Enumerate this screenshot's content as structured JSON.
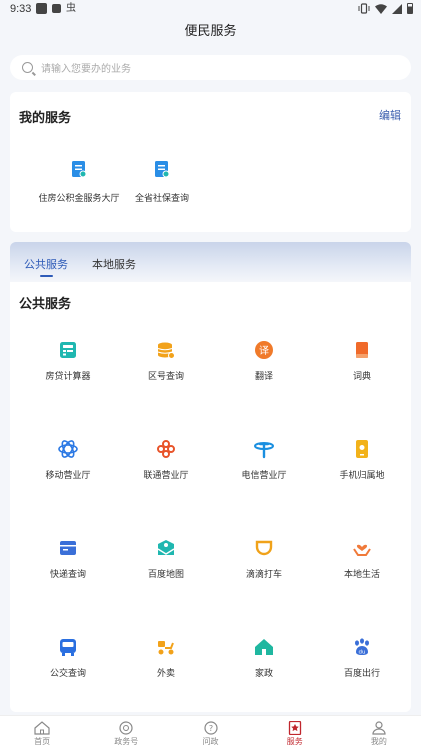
{
  "status_bar": {
    "time": "9:33",
    "notif_glyph": "虫"
  },
  "header": {
    "title": "便民服务"
  },
  "search": {
    "placeholder": "请输入您要办的业务"
  },
  "my_services": {
    "title": "我的服务",
    "edit_label": "编辑",
    "items": [
      {
        "label": "住房公积金服务大厅",
        "icon": "document-icon"
      },
      {
        "label": "全省社保查询",
        "icon": "document-icon"
      }
    ]
  },
  "tabs": [
    {
      "label": "公共服务",
      "active": true
    },
    {
      "label": "本地服务",
      "active": false
    }
  ],
  "public_services": {
    "title": "公共服务",
    "items": [
      {
        "label": "房贷计算器",
        "icon": "calculator-icon",
        "color": "#1fb7b0"
      },
      {
        "label": "区号查询",
        "icon": "coins-icon",
        "color": "#f2a21a"
      },
      {
        "label": "翻译",
        "icon": "translate-icon",
        "color": "#f07a2a"
      },
      {
        "label": "词典",
        "icon": "book-icon",
        "color": "#f06a2a"
      },
      {
        "label": "移动营业厅",
        "icon": "china-mobile-icon",
        "color": "#2a78e4"
      },
      {
        "label": "联通营业厅",
        "icon": "china-unicom-icon",
        "color": "#e8542a"
      },
      {
        "label": "电信营业厅",
        "icon": "china-telecom-icon",
        "color": "#1a8fe0"
      },
      {
        "label": "手机归属地",
        "icon": "phone-location-icon",
        "color": "#f2b21a"
      },
      {
        "label": "快递查询",
        "icon": "parcel-icon",
        "color": "#3a6fd8"
      },
      {
        "label": "百度地图",
        "icon": "map-icon",
        "color": "#1fb7b0"
      },
      {
        "label": "滴滴打车",
        "icon": "didi-icon",
        "color": "#f0a21a"
      },
      {
        "label": "本地生活",
        "icon": "hands-heart-icon",
        "color": "#f07a3a"
      },
      {
        "label": "公交查询",
        "icon": "bus-icon",
        "color": "#2a6fe0"
      },
      {
        "label": "外卖",
        "icon": "delivery-scooter-icon",
        "color": "#f2a21a"
      },
      {
        "label": "家政",
        "icon": "house-icon",
        "color": "#1fb7a0"
      },
      {
        "label": "百度出行",
        "icon": "paw-icon",
        "color": "#3a6fd8"
      }
    ]
  },
  "bottom_nav": [
    {
      "label": "首页",
      "icon": "home-icon",
      "active": false
    },
    {
      "label": "政务号",
      "icon": "gov-badge-icon",
      "active": false
    },
    {
      "label": "问政",
      "icon": "question-icon",
      "active": false
    },
    {
      "label": "服务",
      "icon": "service-star-icon",
      "active": true
    },
    {
      "label": "我的",
      "icon": "user-icon",
      "active": false
    }
  ],
  "colors": {
    "accent": "#2e5bb8",
    "active_nav": "#c0262d",
    "edit": "#3a5dae"
  }
}
